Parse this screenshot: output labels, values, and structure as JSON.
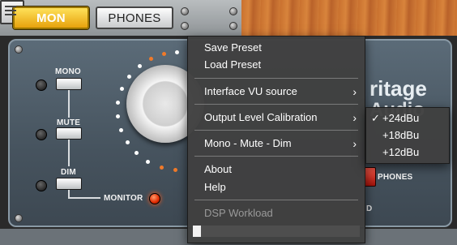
{
  "topbar": {
    "mon_label": "MON",
    "phones_label": "PHONES",
    "mon_color": "#f5c02a"
  },
  "panel": {
    "mono_label": "MONO",
    "mute_label": "MUTE",
    "dim_label": "DIM",
    "monitor_label": "MONITOR",
    "phones_label": "PHONES",
    "brand_line1": "ritage",
    "brand_line2": "Audio",
    "brand_partial": "D"
  },
  "menu": {
    "items": [
      {
        "label": "Save Preset"
      },
      {
        "label": "Load Preset"
      },
      {
        "label": "Interface VU source",
        "submenu": true
      },
      {
        "label": "Output Level Calibration",
        "submenu": true
      },
      {
        "label": "Mono - Mute - Dim",
        "submenu": true
      },
      {
        "label": "About"
      },
      {
        "label": "Help"
      },
      {
        "label": "DSP Workload",
        "disabled": true
      }
    ],
    "dsp_workload_fraction": 0.05
  },
  "submenu_calibration": {
    "options": [
      {
        "label": "+24dBu",
        "checked": true
      },
      {
        "label": "+18dBu",
        "checked": false
      },
      {
        "label": "+12dBu",
        "checked": false
      }
    ],
    "check_glyph": "✓"
  }
}
